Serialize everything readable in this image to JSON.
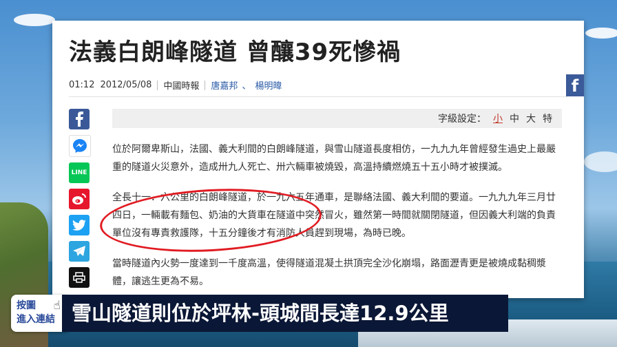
{
  "article": {
    "title": "法義白朗峰隧道 曾釀39死慘禍",
    "time": "01:12",
    "date": "2012/05/08",
    "source": "中國時報",
    "authors": [
      "唐嘉邦",
      "楊明暐"
    ],
    "author_separator": "、",
    "font_setting_label": "字級設定：",
    "font_sizes": [
      "小",
      "中",
      "大",
      "特"
    ],
    "paragraphs": [
      "位於阿爾卑斯山，法國、義大利間的白朗峰隧道，與雪山隧道長度相仿，一九九九年曾經發生過史上最嚴重的隧道火災意外，造成卅九人死亡、卅六輛車被燒毀，高溫持續燃燒五十五小時才被撲滅。",
      "全長十一．六公里的白朗峰隧道，於一九六五年通車，是聯絡法國、義大利間的要道。一九九九年三月廿四日，一輛載有麵包、奶油的大貨車在隧道中突然冒火，雖然第一時間就關閉隧道，但因義大利端的負責單位沒有專責救護隊，十五分鐘後才有消防人員趕到現場，為時已晚。",
      "當時隧道內火勢一度達到一千度高溫，使得隧道混凝土拱頂完全沙化崩塌，路面瀝青更是被燒成黏稠漿體，讓逃生更為不易。"
    ]
  },
  "share_icons": [
    "facebook-icon",
    "messenger-icon",
    "line-icon",
    "weibo-icon",
    "twitter-icon",
    "telegram-icon",
    "print-icon"
  ],
  "share_line_label": "LINE",
  "right_fb_label": "f",
  "click_badge": {
    "line1": "按圖",
    "line2": "進入連結"
  },
  "caption": "雪山隧道則位於坪林-頭城間長達12.9公里",
  "colors": {
    "caption_bg": "#0b1736",
    "highlight_oval": "#e11b22",
    "author_link": "#2a5aa6"
  }
}
